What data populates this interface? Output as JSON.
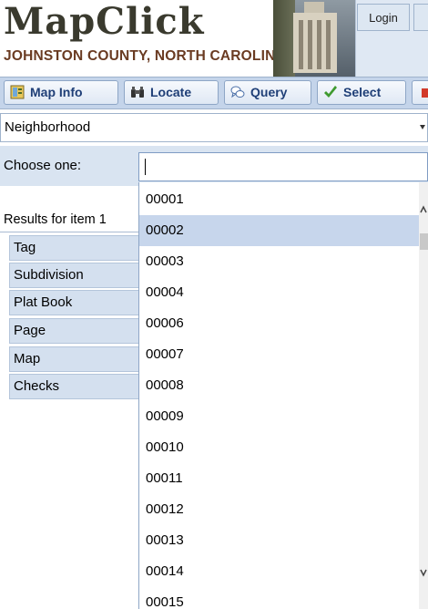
{
  "header": {
    "logo_title": "MapClick",
    "logo_subtitle": "JOHNSTON COUNTY, NORTH CAROLINA",
    "login_label": "Login"
  },
  "toolbar": {
    "tabs": [
      {
        "label": "Map Info",
        "icon": "map-info-icon"
      },
      {
        "label": "Locate",
        "icon": "binoculars-icon"
      },
      {
        "label": "Query",
        "icon": "speech-bubbles-icon"
      },
      {
        "label": "Select",
        "icon": "checkmark-icon"
      }
    ]
  },
  "search_type": {
    "selected": "Neighborhood"
  },
  "choose": {
    "label": "Choose one:",
    "value": ""
  },
  "results": {
    "title": "Results for item 1",
    "fields": [
      "Tag",
      "Subdivision",
      "Plat Book",
      "Page",
      "Map",
      "Checks"
    ]
  },
  "dropdown": {
    "selected": "00002",
    "options": [
      "00001",
      "00002",
      "00003",
      "00004",
      "00006",
      "00007",
      "00008",
      "00009",
      "00010",
      "00011",
      "00012",
      "00013",
      "00014",
      "00015"
    ]
  },
  "colors": {
    "toolbar_bg": "#c4d4ea",
    "tab_text": "#1f3f77",
    "selected_option": "#c7d6ec",
    "subtitle_text": "#6a3b22"
  }
}
